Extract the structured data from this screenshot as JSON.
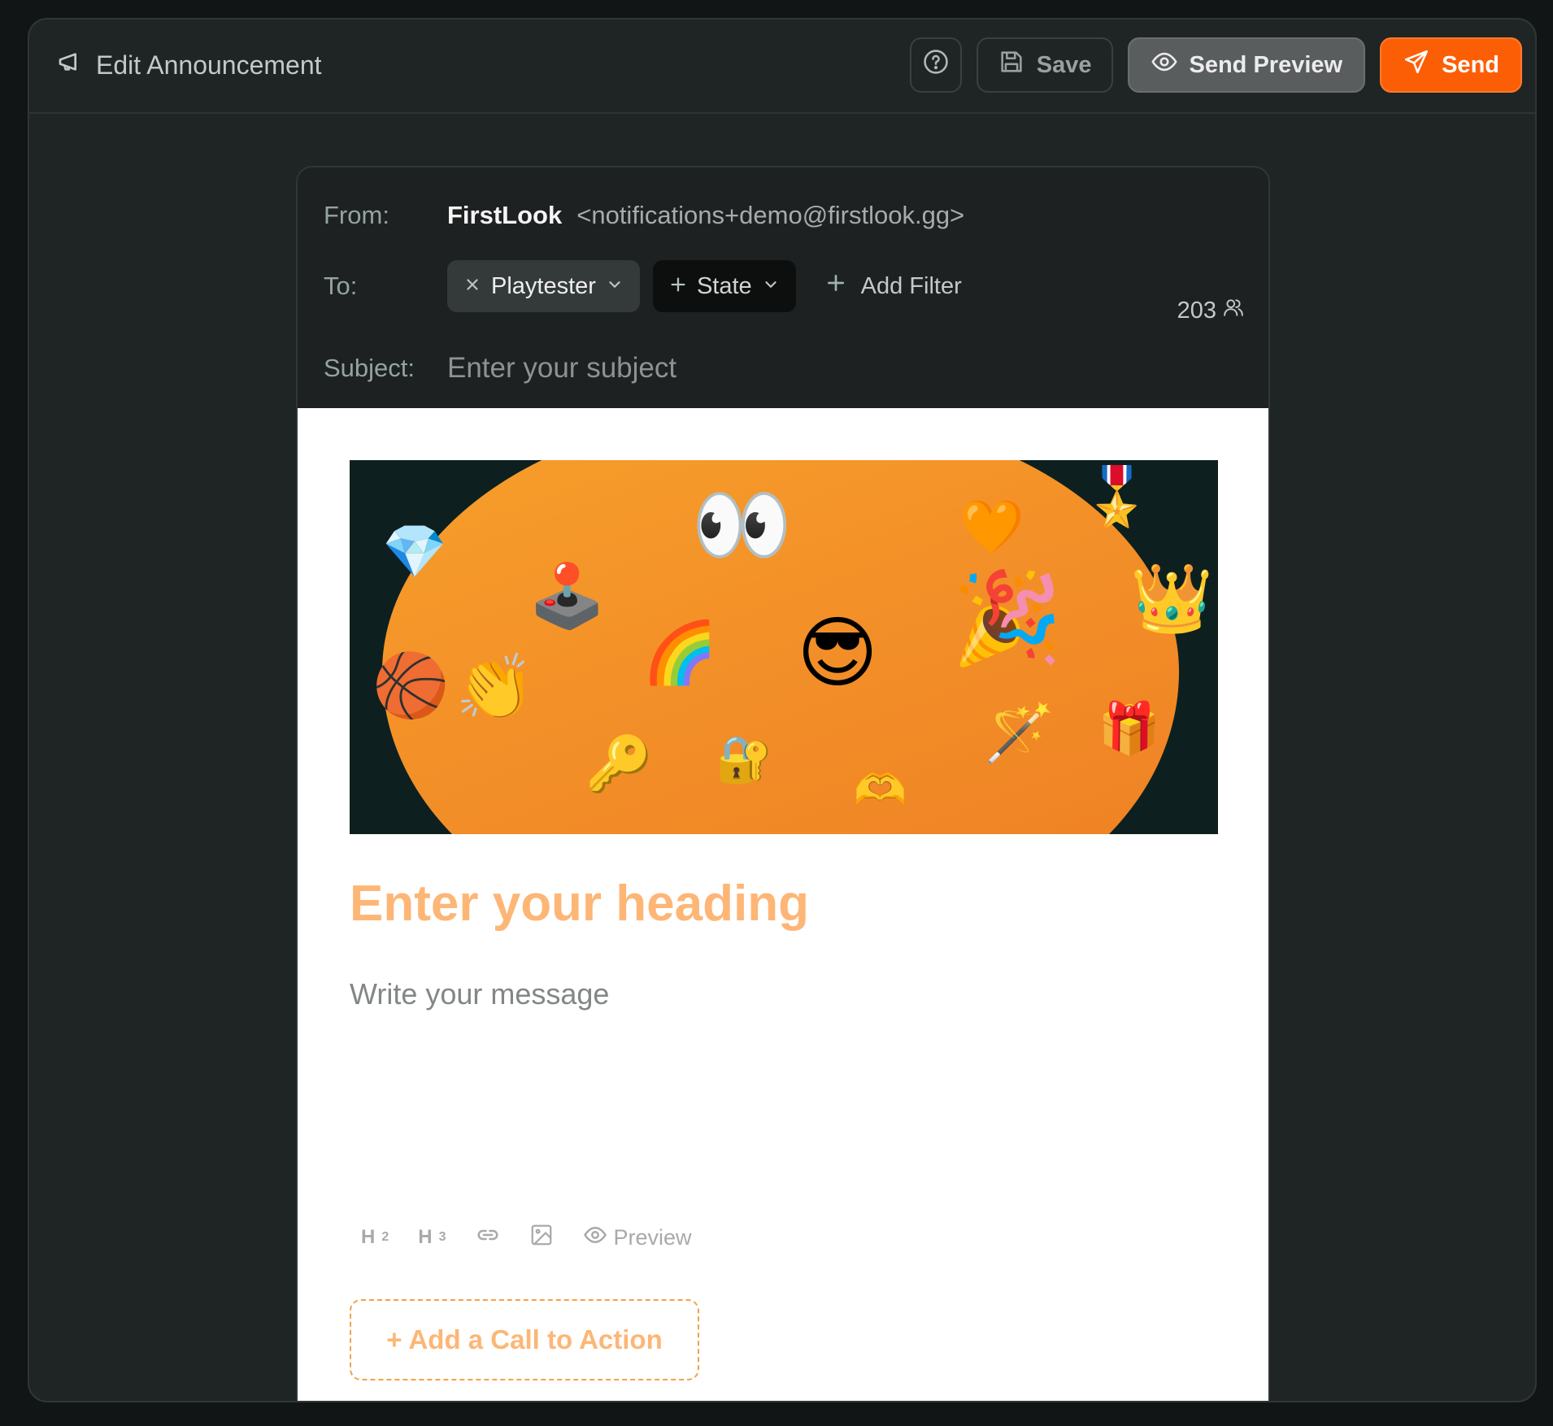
{
  "header": {
    "title": "Edit Announcement",
    "title_icon": "megaphone-icon",
    "help_icon": "help-circle-icon",
    "save_label": "Save",
    "send_preview_label": "Send Preview",
    "send_label": "Send"
  },
  "email": {
    "from_label": "From:",
    "from_name": "FirstLook",
    "from_address": "<notifications+demo@firstlook.gg>",
    "to_label": "To:",
    "filters": [
      {
        "label": "Playtester",
        "removable": true
      },
      {
        "label": "State",
        "removable": false
      }
    ],
    "add_filter_label": "Add Filter",
    "recipient_count": "203",
    "subject_label": "Subject:",
    "subject_placeholder": "Enter your subject",
    "subject_value": ""
  },
  "content": {
    "banner_emojis": [
      "gem",
      "eyes",
      "joystick",
      "rainbow",
      "sunglasses-face",
      "heart",
      "party-popper",
      "medal",
      "crown",
      "basketball",
      "clapping-hands",
      "key",
      "lock-with-key",
      "heart-hands",
      "magic-wand",
      "gift"
    ],
    "heading_placeholder": "Enter your heading",
    "message_placeholder": "Write your message",
    "toolbar": {
      "h2_label": "H",
      "h2_sub": "2",
      "h3_label": "H",
      "h3_sub": "3",
      "link_icon": "link-icon",
      "image_icon": "image-icon",
      "preview_label": "Preview"
    },
    "cta_label": "+ Add a Call to Action"
  },
  "colors": {
    "accent": "#fc5e06",
    "heading_placeholder": "#fdb676",
    "window_bg": "#1f2424"
  }
}
